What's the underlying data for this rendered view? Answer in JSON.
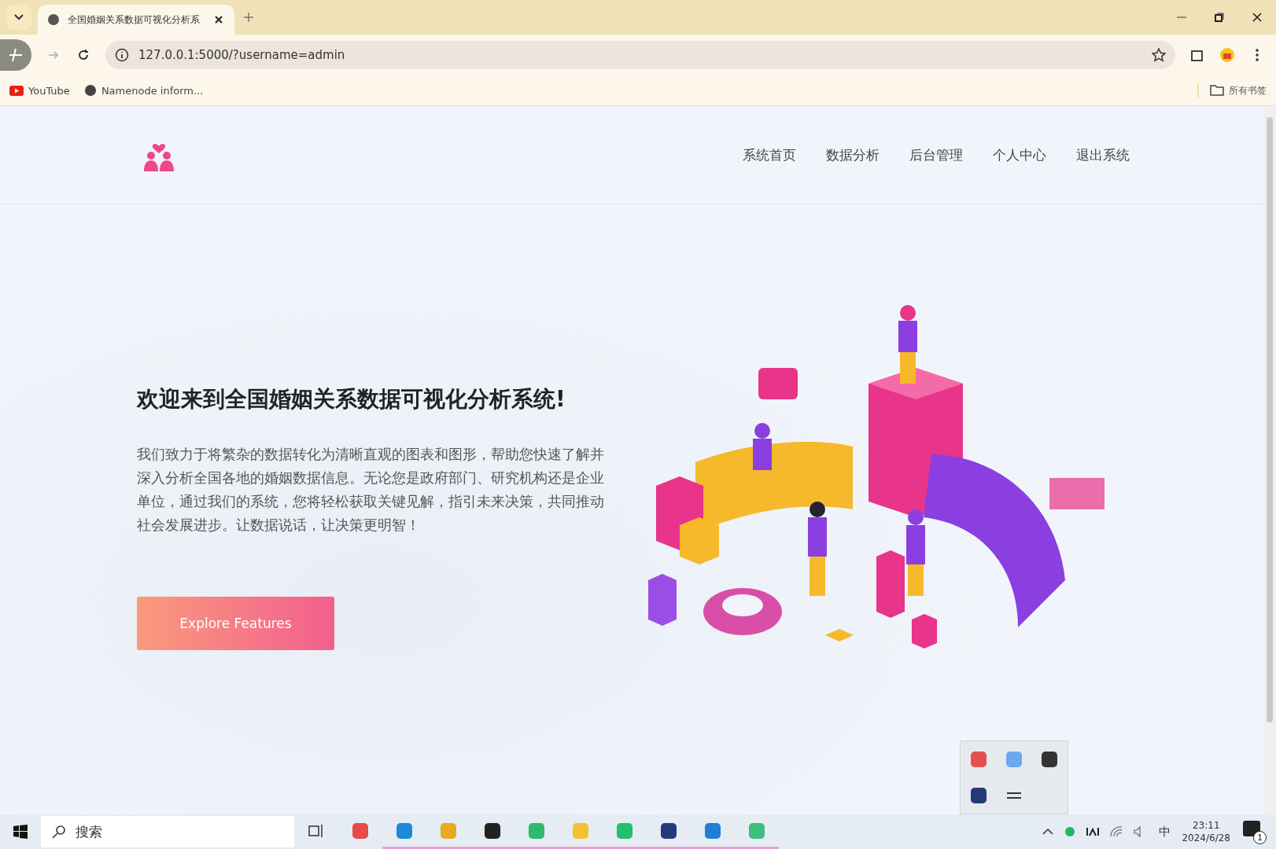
{
  "browser": {
    "tab_title": "全国婚姻关系数据可视化分析系",
    "url": "127.0.0.1:5000/?username=admin",
    "bookmarks": [
      "YouTube",
      "Namenode inform..."
    ],
    "all_bookmarks": "所有书签"
  },
  "nav": {
    "items": [
      "系统首页",
      "数据分析",
      "后台管理",
      "个人中心",
      "退出系统"
    ]
  },
  "hero": {
    "title": "欢迎来到全国婚姻关系数据可视化分析系统!",
    "text": "我们致力于将繁杂的数据转化为清晰直观的图表和图形，帮助您快速了解并深入分析全国各地的婚姻数据信息。无论您是政府部门、研究机构还是企业单位，通过我们的系统，您将轻松获取关键见解，指引未来决策，共同推动社会发展进步。让数据说话，让决策更明智！",
    "button": "Explore Features"
  },
  "taskbar": {
    "search": {
      "placeholder": "搜索"
    },
    "ime": "中",
    "time": "23:11",
    "date": "2024/6/28",
    "notifications": "1"
  }
}
